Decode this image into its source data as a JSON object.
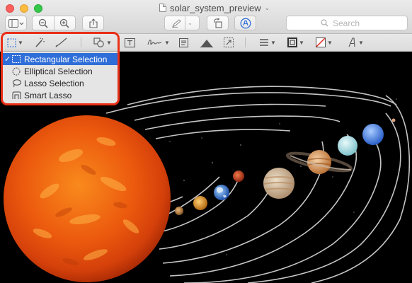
{
  "window": {
    "title": "solar_system_preview",
    "search_placeholder": "Search"
  },
  "menu": {
    "items": [
      {
        "label": "Rectangular Selection",
        "icon": "rect-dashed-icon",
        "selected": true,
        "check": "✓"
      },
      {
        "label": "Elliptical Selection",
        "icon": "ellipse-dashed-icon",
        "selected": false,
        "check": ""
      },
      {
        "label": "Lasso Selection",
        "icon": "lasso-icon",
        "selected": false,
        "check": ""
      },
      {
        "label": "Smart Lasso",
        "icon": "smart-lasso-icon",
        "selected": false,
        "check": ""
      }
    ]
  },
  "colors": {
    "highlight": "#ea2f16",
    "menu_selected": "#2f6ed8",
    "sun": "#ec5a0e"
  }
}
